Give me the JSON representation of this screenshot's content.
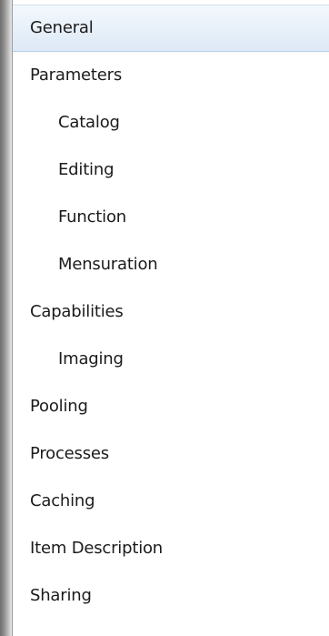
{
  "nav": {
    "items": [
      {
        "label": "General",
        "level": 0,
        "selected": true
      },
      {
        "label": "Parameters",
        "level": 0,
        "selected": false
      },
      {
        "label": "Catalog",
        "level": 1,
        "selected": false
      },
      {
        "label": "Editing",
        "level": 1,
        "selected": false
      },
      {
        "label": "Function",
        "level": 1,
        "selected": false
      },
      {
        "label": "Mensuration",
        "level": 1,
        "selected": false
      },
      {
        "label": "Capabilities",
        "level": 0,
        "selected": false
      },
      {
        "label": "Imaging",
        "level": 1,
        "selected": false
      },
      {
        "label": "Pooling",
        "level": 0,
        "selected": false
      },
      {
        "label": "Processes",
        "level": 0,
        "selected": false
      },
      {
        "label": "Caching",
        "level": 0,
        "selected": false
      },
      {
        "label": "Item Description",
        "level": 0,
        "selected": false
      },
      {
        "label": "Sharing",
        "level": 0,
        "selected": false
      }
    ]
  },
  "colors": {
    "selected_bg": "#dde9f6",
    "text": "#1b1b1b"
  }
}
